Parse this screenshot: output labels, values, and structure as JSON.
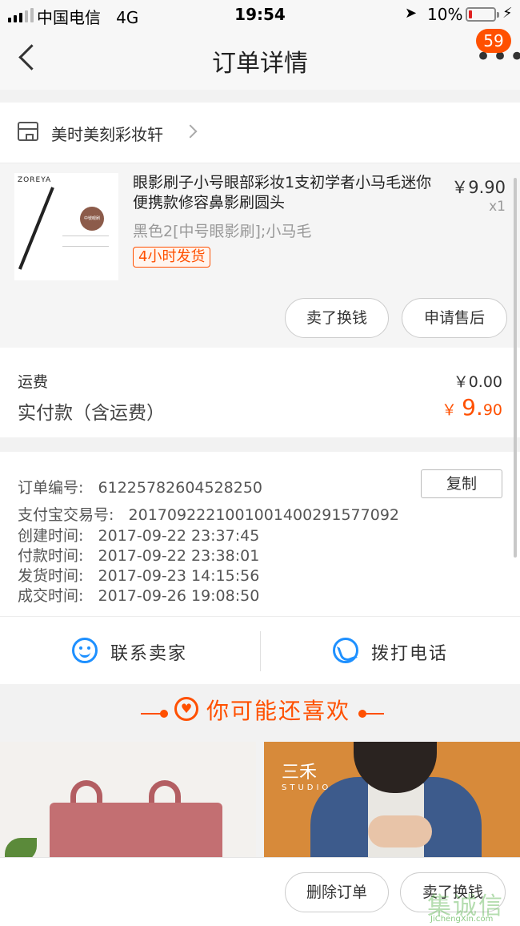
{
  "status_bar": {
    "carrier": "中国电信",
    "network": "4G",
    "time": "19:54",
    "battery": "10%"
  },
  "nav": {
    "title": "订单详情",
    "badge_count": "59",
    "more_icon": "•••"
  },
  "shop": {
    "name": "美时美刻彩妆轩"
  },
  "product": {
    "thumb_brand": "ZOREYA",
    "thumb_badge": "中號眼刷",
    "title": "眼影刷子小号眼部彩妆1支初学者小马毛迷你便携款修容鼻影刷圆头",
    "price": "￥9.90",
    "quantity": "x1",
    "sku": "黑色2[中号眼影刷];小马毛",
    "tag": "4小时发货",
    "actions": {
      "sell": "卖了换钱",
      "after_sale": "申请售后"
    }
  },
  "fees": {
    "shipping_label": "运费",
    "shipping_value": "￥0.00",
    "paid_label": "实付款（含运费）",
    "paid_currency": "￥",
    "paid_int": "9.",
    "paid_dec": "90"
  },
  "order_info": {
    "rows": [
      {
        "text": "订单编号:   61225782604528250"
      },
      {
        "text": "支付宝交易号:   2017092221001001400291577092"
      },
      {
        "text": "创建时间:   2017-09-22 23:37:45"
      },
      {
        "text": "付款时间:   2017-09-22 23:38:01"
      },
      {
        "text": "发货时间:   2017-09-23 14:15:56"
      },
      {
        "text": "成交时间:   2017-09-26 19:08:50"
      }
    ],
    "copy_label": "复制"
  },
  "contact": {
    "seller": "联系卖家",
    "phone": "拨打电话"
  },
  "recommend": {
    "title": "你可能还喜欢",
    "shirt_brand": "三禾",
    "shirt_brand_sub": "STUDIO"
  },
  "bottom": {
    "delete": "删除订单",
    "sell": "卖了换钱"
  },
  "watermark": {
    "main": "集诚信",
    "sub": "JiChengXin.com"
  },
  "colors": {
    "accent": "#ff5000",
    "link_blue": "#1e90ff"
  }
}
